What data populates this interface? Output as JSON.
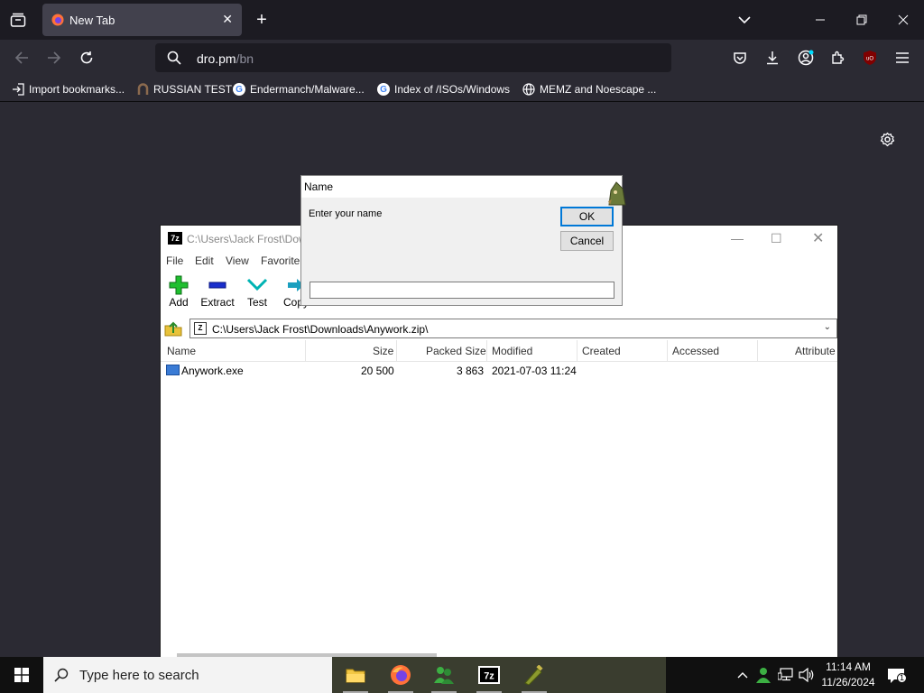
{
  "browser": {
    "tab": {
      "title": "New Tab"
    },
    "url": {
      "host": "dro.pm",
      "path": "/bn"
    },
    "bookmarks": [
      {
        "label": "Import bookmarks..."
      },
      {
        "label": "RUSSIAN TEST"
      },
      {
        "label": "Endermanch/Malware..."
      },
      {
        "label": "Index of /ISOs/Windows"
      },
      {
        "label": "MEMZ and Noescape ..."
      }
    ]
  },
  "sevenzip": {
    "title": "C:\\Users\\Jack Frost\\Dow",
    "menu": [
      "File",
      "Edit",
      "View",
      "Favorite"
    ],
    "toolbar": [
      "Add",
      "Extract",
      "Test",
      "Copy"
    ],
    "address": "C:\\Users\\Jack Frost\\Downloads\\Anywork.zip\\",
    "columns": [
      "Name",
      "Size",
      "Packed Size",
      "Modified",
      "Created",
      "Accessed",
      "Attribute"
    ],
    "rows": [
      {
        "name": "Anywork.exe",
        "size": "20 500",
        "packed": "3 863",
        "modified": "2021-07-03 11:24"
      }
    ]
  },
  "dialog": {
    "title": "Name",
    "prompt": "Enter your name",
    "ok_label": "OK",
    "cancel_label": "Cancel",
    "input_value": ""
  },
  "taskbar": {
    "search_placeholder": "Type here to search",
    "time": "11:14 AM",
    "date": "11/26/2024",
    "notification_count": "1"
  },
  "colors": {
    "firefox_bg": "#2b2a33",
    "firefox_tabbar": "#1c1b22",
    "dialog_default_border": "#0078d7",
    "taskbar": "#101010"
  }
}
